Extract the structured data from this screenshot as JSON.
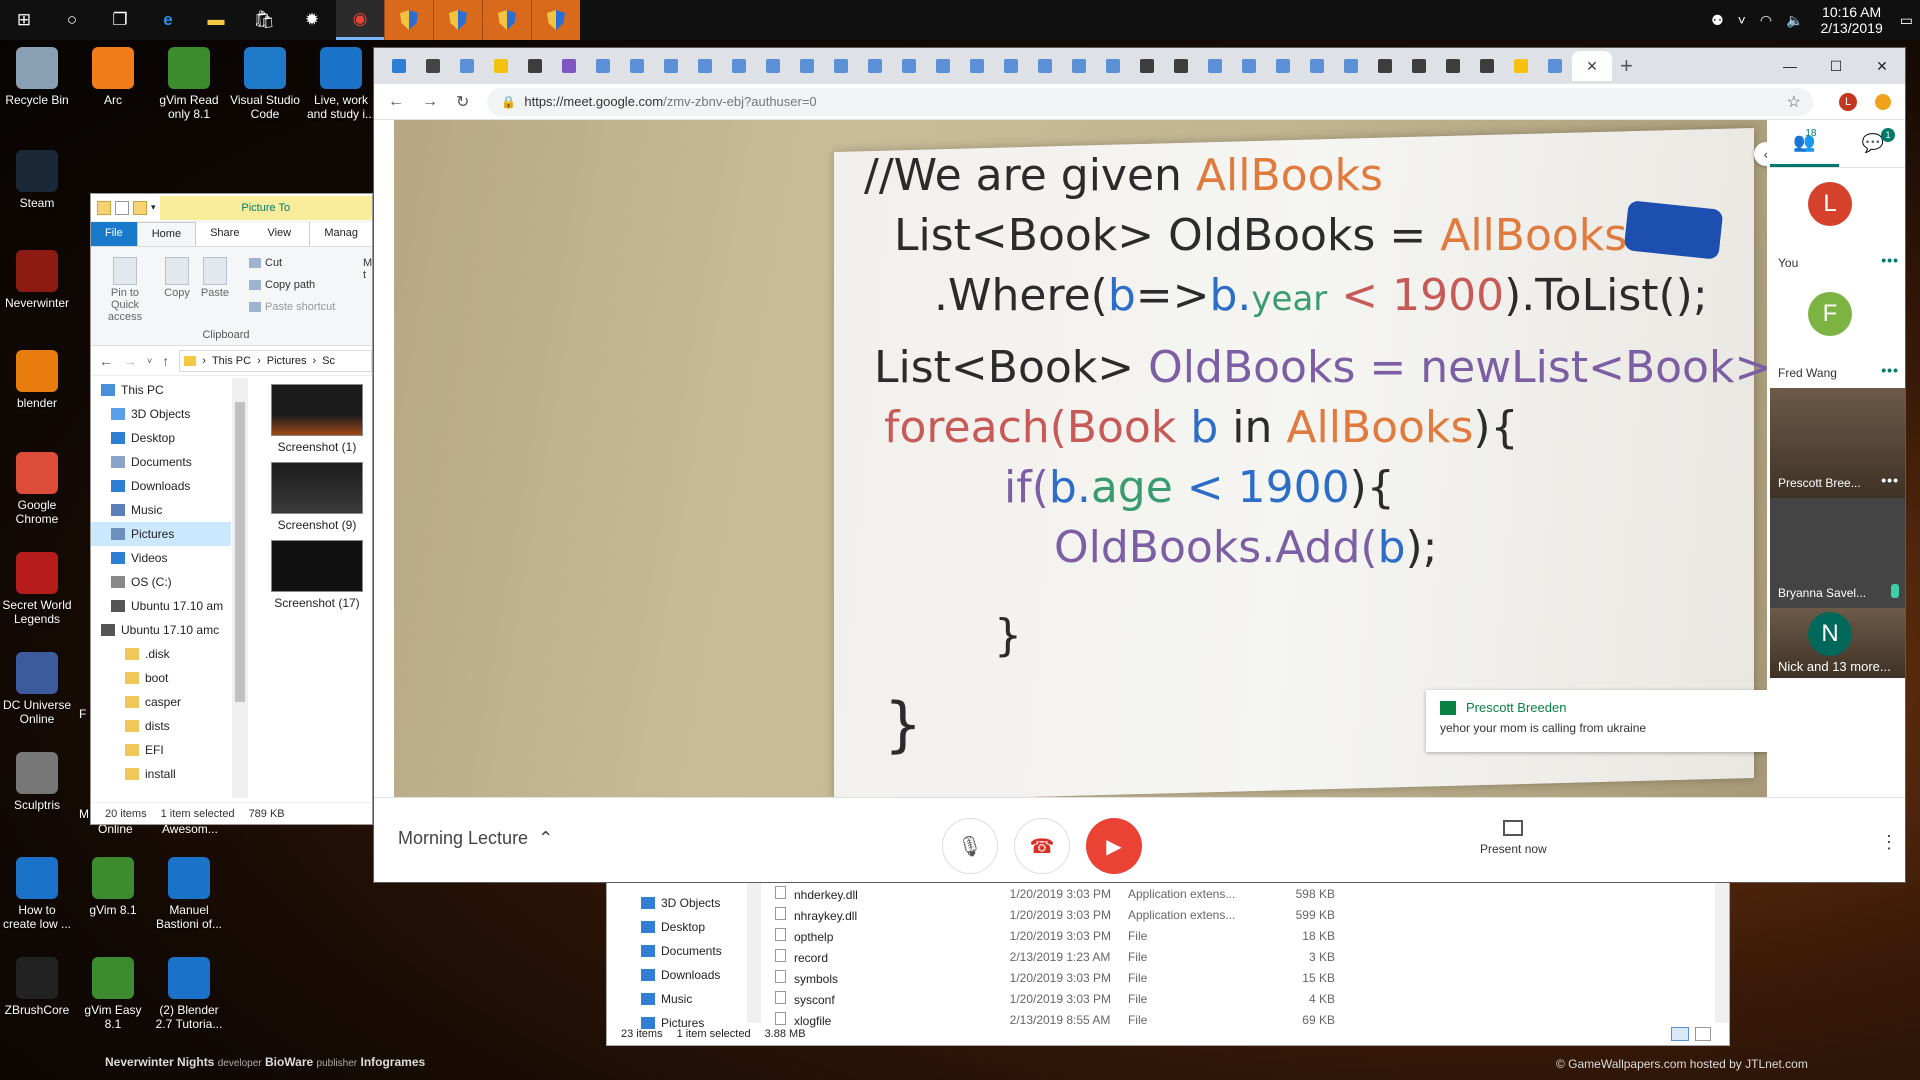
{
  "taskbar": {
    "time": "10:16 AM",
    "date": "2/13/2019"
  },
  "desktop_icons": [
    {
      "label": "Recycle Bin",
      "color": "#8aa0b4"
    },
    {
      "label": "Arc",
      "color": "#f07d1a"
    },
    {
      "label": "gVim Read only 8.1",
      "color": "#3c8b2e"
    },
    {
      "label": "Visual Studio Code",
      "color": "#1f79c9"
    },
    {
      "label": "Live, work and study i...",
      "color": "#1a73c8"
    },
    {
      "label": "Steam",
      "color": "#1b2838"
    },
    {
      "label": "Neverwinter",
      "color": "#8e1b12"
    },
    {
      "label": "blender",
      "color": "#e87d0d"
    },
    {
      "label": "Google Chrome",
      "color": "#dd4b39"
    },
    {
      "label": "Secret World Legends",
      "color": "#b71c1c"
    },
    {
      "label": "DC Universe Online",
      "color": "#3b5b9d"
    },
    {
      "label": "Sculptris",
      "color": "#777777"
    },
    {
      "label": "How to create low ...",
      "color": "#1a73c8"
    },
    {
      "label": "gVim 8.1",
      "color": "#3c8b2e"
    },
    {
      "label": "Manuel Bastioni of...",
      "color": "#1a73c8"
    },
    {
      "label": "ZBrushCore",
      "color": "#222222"
    },
    {
      "label": "gVim Easy 8.1",
      "color": "#3c8b2e"
    },
    {
      "label": "(2) Blender 2.7 Tutoria...",
      "color": "#1a73c8"
    }
  ],
  "behind_labels": [
    "M",
    "F",
    "M",
    "Online",
    "Awesom..."
  ],
  "explorer": {
    "tab_picture": "Picture To",
    "tab_manage": "Manag",
    "tabs": [
      "File",
      "Home",
      "Share",
      "View"
    ],
    "ribbon": {
      "pin": "Pin to Quick access",
      "copy": "Copy",
      "paste": "Paste",
      "cut": "Cut",
      "copy_path": "Copy path",
      "paste_shortcut": "Paste shortcut",
      "group": "Clipboard",
      "move_a": "M",
      "move_b": "t"
    },
    "breadcrumb": [
      "This PC",
      "Pictures",
      "Sc"
    ],
    "nav": [
      "This PC",
      "3D Objects",
      "Desktop",
      "Documents",
      "Downloads",
      "Music",
      "Pictures",
      "Videos",
      "OS (C:)",
      "Ubuntu 17.10 am",
      "Ubuntu 17.10 amc",
      ".disk",
      "boot",
      "casper",
      "dists",
      "EFI",
      "install"
    ],
    "thumbnails": [
      "Screenshot (1)",
      "Screenshot (9)",
      "Screenshot (17)"
    ],
    "status": {
      "count": "20 items",
      "selected": "1 item selected",
      "size": "789 KB"
    }
  },
  "explorer2": {
    "nav": [
      "3D Objects",
      "Desktop",
      "Documents",
      "Downloads",
      "Music",
      "Pictures"
    ],
    "rows": [
      {
        "name": "nhderkey.dll",
        "date": "1/20/2019 3:03 PM",
        "type": "Application extens...",
        "size": "598 KB"
      },
      {
        "name": "nhraykey.dll",
        "date": "1/20/2019 3:03 PM",
        "type": "Application extens...",
        "size": "599 KB"
      },
      {
        "name": "opthelp",
        "date": "1/20/2019 3:03 PM",
        "type": "File",
        "size": "18 KB"
      },
      {
        "name": "record",
        "date": "2/13/2019 1:23 AM",
        "type": "File",
        "size": "3 KB"
      },
      {
        "name": "symbols",
        "date": "1/20/2019 3:03 PM",
        "type": "File",
        "size": "15 KB"
      },
      {
        "name": "sysconf",
        "date": "1/20/2019 3:03 PM",
        "type": "File",
        "size": "4 KB"
      },
      {
        "name": "xlogfile",
        "date": "2/13/2019 8:55 AM",
        "type": "File",
        "size": "69 KB"
      }
    ],
    "status": {
      "count": "23 items",
      "selected": "1 item selected",
      "size": "3.88 MB"
    }
  },
  "wallpaper": {
    "credit_left_a": "Neverwinter Nights",
    "credit_left_b": "developer",
    "credit_left_c": "BioWare",
    "credit_left_d": "publisher",
    "credit_left_e": "Infogrames",
    "credit_right": "© GameWallpapers.com hosted by JTLnet.com"
  },
  "chrome": {
    "url_host": "https://meet.google.com",
    "url_path": "/zmv-zbnv-ebj?authuser=0",
    "profile_initial": "L",
    "tab_colors": [
      "#2e7dd7",
      "#444444",
      "#5b8fd6",
      "#f4c20d",
      "#3d3d3d",
      "#7e57c2"
    ]
  },
  "whiteboard": {
    "line1a": "//We are given",
    "line1b": "AllBooks",
    "line2a": "List<Book> OldBooks =",
    "line2b": "AllBooks",
    "line3a": ".Where(",
    "line3b": "b",
    "line3c": "=>",
    "line3d": "b.",
    "line3e": "year",
    "line3f": "< 1900",
    "line3g": ").ToList();",
    "line4a": "List<Book>",
    "line4b": "OldBooks = newList<Book>();",
    "line5a": "foreach(Book",
    "line5b": "b",
    "line5c": "in",
    "line5d": "AllBooks",
    "line5e": "){",
    "line6a": "if(",
    "line6b": "b.",
    "line6c": "age",
    "line6d": "< 1900",
    "line6e": "){",
    "line7a": "OldBooks.Add(",
    "line7b": "b",
    "line7c": ");",
    "brace1": "}",
    "brace2": "}"
  },
  "notification": {
    "name": "Prescott Breeden",
    "message": "yehor your mom is calling from ukraine"
  },
  "participants": {
    "people_count": "18",
    "chat_count": "1",
    "list": [
      {
        "name": "You",
        "initial": "L",
        "color": "#d6412b"
      },
      {
        "name": "Fred Wang",
        "initial": "F",
        "color": "#7cb342"
      },
      {
        "name": "Prescott Bree...",
        "initial": ""
      },
      {
        "name": "Bryanna Savel...",
        "initial": ""
      },
      {
        "name": "Nick and 13 more...",
        "initial": "N",
        "color": "#00695c"
      }
    ]
  },
  "meeting": {
    "title": "Morning Lecture",
    "present_label": "Present now"
  }
}
